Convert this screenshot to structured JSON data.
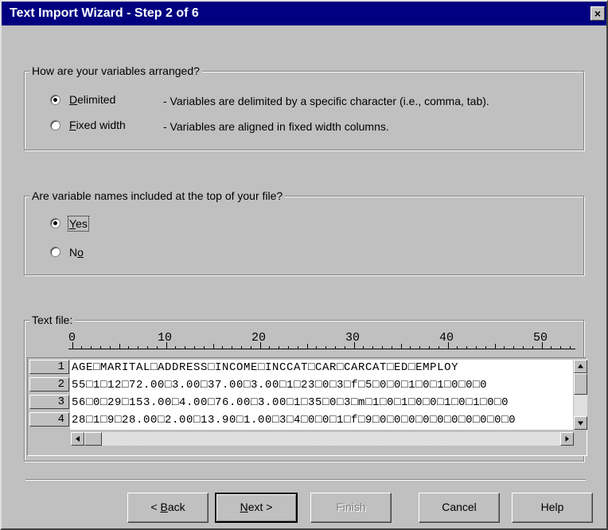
{
  "window": {
    "title": "Text Import Wizard - Step 2 of 6",
    "close_glyph": "×"
  },
  "arrangement": {
    "legend": "How are your variables arranged?",
    "options": [
      {
        "prefix": "",
        "mnemonic": "D",
        "rest": "elimited",
        "selected": true,
        "description": "- Variables are delimited by a specific character (i.e., comma, tab)."
      },
      {
        "prefix": "",
        "mnemonic": "F",
        "rest": "ixed width",
        "selected": false,
        "description": "- Variables are aligned in fixed width columns."
      }
    ]
  },
  "names": {
    "legend": "Are variable names included at the top of your file?",
    "options": [
      {
        "prefix": "",
        "mnemonic": "Y",
        "rest": "es",
        "selected": true
      },
      {
        "prefix": "N",
        "mnemonic": "o",
        "rest": "",
        "selected": false
      }
    ]
  },
  "text_file": {
    "legend": "Text file:",
    "ruler_labels": [
      "0",
      "10",
      "20",
      "30",
      "40",
      "50"
    ],
    "rows": [
      {
        "num": "1",
        "text": "AGE□MARITAL□ADDRESS□INCOME□INCCAT□CAR□CARCAT□ED□EMPLOY"
      },
      {
        "num": "2",
        "text": "55□1□12□72.00□3.00□37.00□3.00□1□23□0□3□f□5□0□0□1□0□1□0□0□0"
      },
      {
        "num": "3",
        "text": "56□0□29□153.00□4.00□76.00□3.00□1□35□0□3□m□1□0□1□0□0□1□0□1□0□0"
      },
      {
        "num": "4",
        "text": "28□1□9□28.00□2.00□13.90□1.00□3□4□0□0□1□f□9□0□0□0□0□0□0□0□0□0□0"
      }
    ]
  },
  "buttons": {
    "back": {
      "mnemonic": "B",
      "rest": "ack",
      "prefix": "< "
    },
    "next": {
      "mnemonic": "N",
      "rest": "ext >",
      "prefix": ""
    },
    "finish": "Finish",
    "cancel": "Cancel",
    "help": "Help"
  },
  "icons": {
    "close": "close-icon",
    "scroll_up": "arrow-up-icon",
    "scroll_down": "arrow-down-icon",
    "scroll_left": "arrow-left-icon",
    "scroll_right": "arrow-right-icon"
  }
}
